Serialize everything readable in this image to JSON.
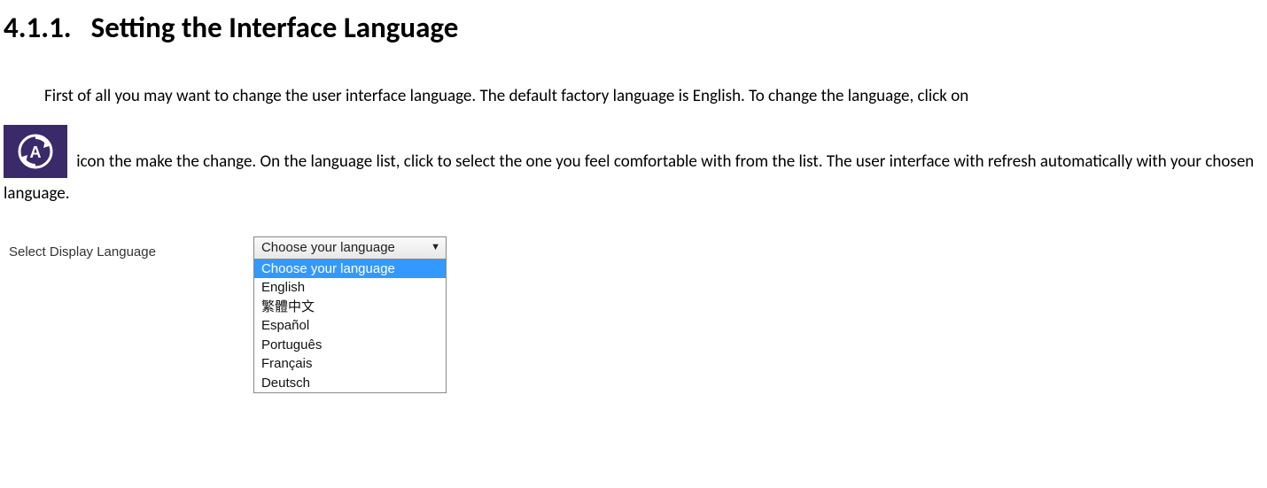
{
  "heading": {
    "number": "4.1.1.",
    "title": "Setting the Interface Language"
  },
  "body": {
    "para1": "First of all you may want to change the user interface language. The default factory language is English. To change the language, click on",
    "para2_after_icon": " icon the make the change. On the language list, click to select the one you feel comfortable with from the list. The user interface with refresh automatically with your chosen language.",
    "icon_name": "refresh-language-icon"
  },
  "selector": {
    "label": "Select Display Language",
    "selected": "Choose your language",
    "options": [
      "Choose your language",
      "English",
      "繁體中文",
      "Español",
      "Português",
      "Français",
      "Deutsch"
    ]
  }
}
